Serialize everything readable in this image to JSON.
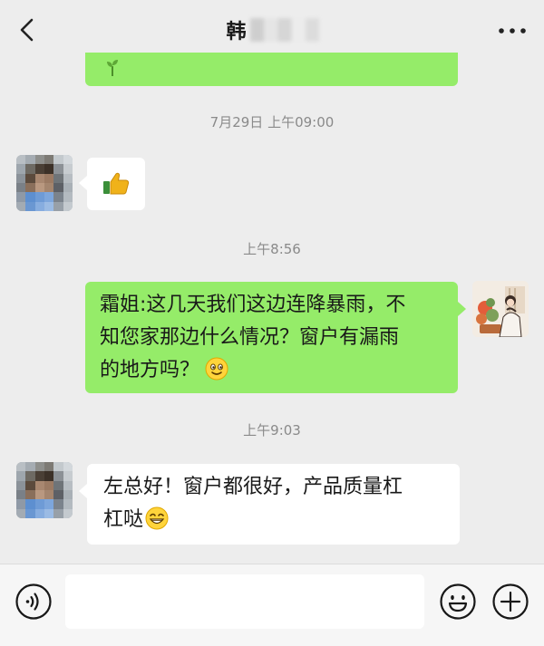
{
  "header": {
    "title": "韩",
    "back_icon": "chevron-left-icon",
    "more_icon": "more-dots-icon"
  },
  "conversation": {
    "prev_message_icon": "sprout-icon",
    "messages": [
      {
        "type": "timestamp",
        "text": "7月29日 上午09:00"
      },
      {
        "type": "image",
        "side": "left",
        "icon": "thumbs-up-icon"
      },
      {
        "type": "timestamp",
        "text": "上午8:56"
      },
      {
        "type": "text",
        "side": "right",
        "lines": [
          "霜姐:这几天我们这边连降暴雨，不",
          "知您家那边什么情况？窗户有漏雨",
          "的地方吗？"
        ],
        "emoji": "smile-emoji"
      },
      {
        "type": "timestamp",
        "text": "上午9:03"
      },
      {
        "type": "text",
        "side": "left",
        "lines": [
          "左总好！窗户都很好，产品质量杠",
          "杠哒"
        ],
        "emoji": "grin-emoji"
      }
    ]
  },
  "input_bar": {
    "voice_icon": "voice-icon",
    "input_value": "",
    "input_placeholder": "",
    "emoji_icon": "emoji-face-icon",
    "add_icon": "plus-icon"
  },
  "colors": {
    "background": "#ededed",
    "sent_bubble": "#95ec69",
    "received_bubble": "#ffffff",
    "timestamp_text": "#8a8a8a"
  }
}
